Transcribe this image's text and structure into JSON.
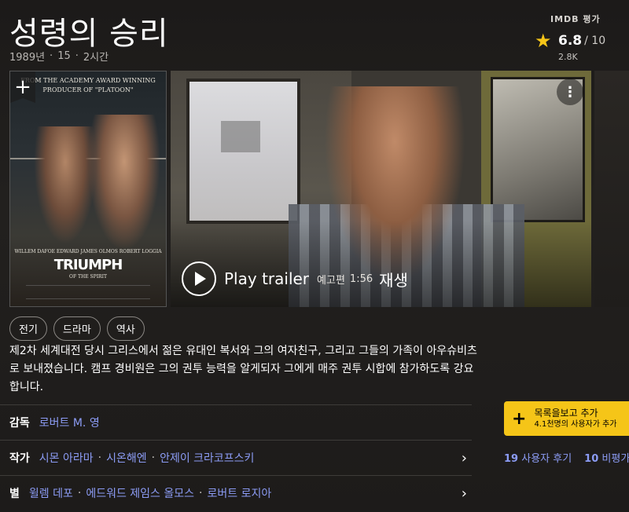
{
  "movie": {
    "title": "성령의 승리",
    "year": "1989년",
    "rating_cert": "15",
    "runtime": "2시간"
  },
  "imdb": {
    "label": "IMDB 평가",
    "score": "6.8",
    "out_of": "/ 10",
    "votes": "2.8K"
  },
  "poster": {
    "top_text": "FROM THE ACADEMY AWARD WINNING PRODUCER OF \"PLATOON\"",
    "names": "WILLEM DAFOE   EDWARD JAMES OLMOS   ROBERT LOGGIA",
    "big_title": "TRIUMPH",
    "subtitle": "OF THE SPIRIT",
    "add_icon": "plus-icon"
  },
  "trailer": {
    "play_label": "Play trailer",
    "kind": "예고편",
    "duration": "1:56",
    "play_word": "재생",
    "menu_icon": "kebab-icon"
  },
  "genres": [
    "전기",
    "드라마",
    "역사"
  ],
  "plot": "제2차 세계대전 당시 그리스에서 젊은 유대인 복서와 그의 여자친구, 그리고 그들의 가족이 아우슈비츠로 보내졌습니다. 캠프 경비원은 그의 권투 능력을 알게되자 그에게 매주 권투 시합에 참가하도록 강요합니다.",
  "credits": {
    "director": {
      "label": "감독",
      "names": [
        "로버트 M. 영"
      ]
    },
    "writers": {
      "label": "작가",
      "names": [
        "시몬 아라마",
        "시온해엔",
        "안제이 크라코프스키"
      ]
    },
    "stars": {
      "label": "별",
      "names": [
        "윌렘 데포",
        "에드워드 제임스 올모스",
        "로버트 로지아"
      ]
    }
  },
  "watchlist": {
    "main": "목록을보고 추가",
    "sub": "4.1천명의 사용자가 추가"
  },
  "reviews": {
    "user_count": "19",
    "user_label": "사용자 후기",
    "critic_count": "10",
    "critic_label": "비평가"
  },
  "colors": {
    "accent": "#f5c518",
    "link": "#8c9cf5",
    "background": "#1c1a19"
  }
}
